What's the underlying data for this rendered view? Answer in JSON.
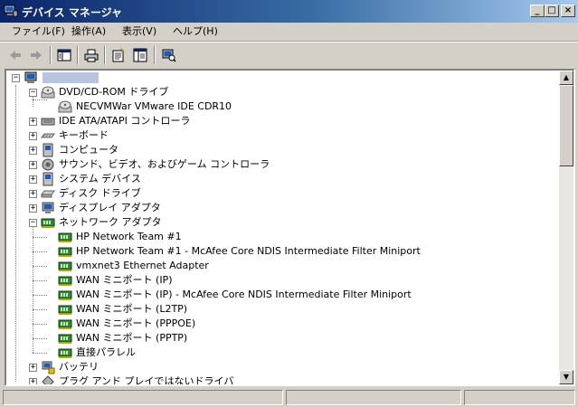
{
  "window": {
    "title": "デバイス マネージャ",
    "buttons": {
      "minimize": "_",
      "maximize": "□",
      "close": "×"
    }
  },
  "menu": [
    "ファイル(F)",
    "操作(A)",
    "表示(V)",
    "ヘルプ(H)"
  ],
  "toolbar": {
    "items": [
      "back-arrow-icon",
      "forward-arrow-icon",
      "show-hide-console-tree-icon",
      "print-icon",
      "properties-icon",
      "help-icon",
      "scan-hardware-icon"
    ]
  },
  "tree": {
    "root": "",
    "categories": [
      {
        "label": "DVD/CD-ROM ドライブ",
        "expanded": true,
        "icon": "cdrom-icon",
        "children": [
          "NECVMWar VMware IDE CDR10"
        ]
      },
      {
        "label": "IDE ATA/ATAPI コントローラ",
        "expanded": false,
        "icon": "ide-controller-icon"
      },
      {
        "label": "キーボード",
        "expanded": false,
        "icon": "keyboard-icon"
      },
      {
        "label": "コンピュータ",
        "expanded": false,
        "icon": "computer-icon"
      },
      {
        "label": "サウンド、ビデオ、およびゲーム コントローラ",
        "expanded": false,
        "icon": "sound-icon"
      },
      {
        "label": "システム デバイス",
        "expanded": false,
        "icon": "system-device-icon"
      },
      {
        "label": "ディスク ドライブ",
        "expanded": false,
        "icon": "disk-drive-icon"
      },
      {
        "label": "ディスプレイ アダプタ",
        "expanded": false,
        "icon": "display-adapter-icon"
      },
      {
        "label": "ネットワーク アダプタ",
        "expanded": true,
        "icon": "network-adapter-icon",
        "children": [
          "HP Network Team #1",
          "HP Network Team #1 - McAfee Core NDIS Intermediate Filter Miniport",
          "vmxnet3 Ethernet Adapter",
          "WAN ミニポート (IP)",
          "WAN ミニポート (IP) - McAfee Core NDIS Intermediate Filter Miniport",
          "WAN ミニポート (L2TP)",
          "WAN ミニポート (PPPOE)",
          "WAN ミニポート (PPTP)",
          "直接パラレル"
        ]
      },
      {
        "label": "バッテリ",
        "expanded": false,
        "icon": "battery-icon"
      },
      {
        "label": "プラグ アンド プレイではないドライバ",
        "expanded": false,
        "icon": "non-pnp-driver-icon"
      }
    ]
  },
  "colors": {
    "title_start": "#0a246a",
    "title_end": "#a6caf0",
    "face": "#d4d0c8"
  }
}
